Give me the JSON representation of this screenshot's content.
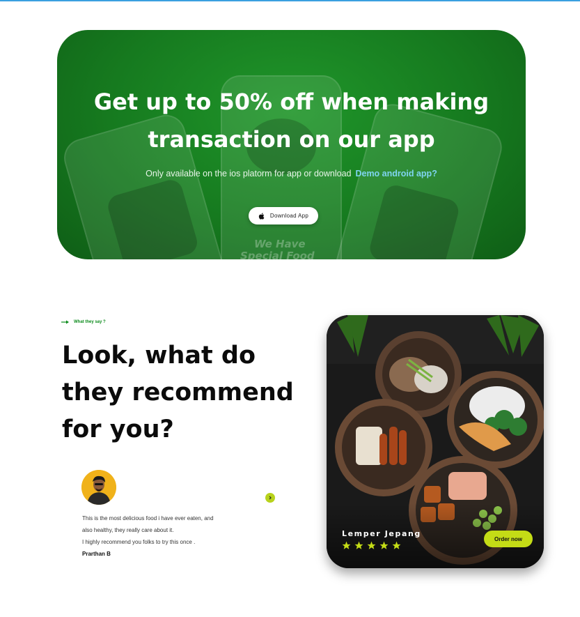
{
  "promo": {
    "title_line1": "Get up to 50% off when making",
    "title_line2": "transaction on our app",
    "subtitle": "Only available on the ios platorm for app or download",
    "android_link": "Demo android app?",
    "download_button": "Download App",
    "ghost_text1": "We Have",
    "ghost_text2": "Special Food",
    "colors": {
      "banner": "#167a1f",
      "link": "#7fd4f0"
    }
  },
  "testimonials": {
    "tag": "What they say ?",
    "heading_lines": [
      "Look, what do",
      "they recommend",
      "for you?"
    ],
    "quote_lines": [
      "This is the most delicious food i have ever eaten, and",
      "also healthy, they really care about it.",
      "I highly recommend you folks to try this once ."
    ],
    "author": "Prarthan B"
  },
  "food_card": {
    "title": "Lemper Jepang",
    "rating": 5,
    "order_button": "Order now",
    "colors": {
      "accent": "#c4dc16",
      "star": "#c4dc16"
    }
  }
}
